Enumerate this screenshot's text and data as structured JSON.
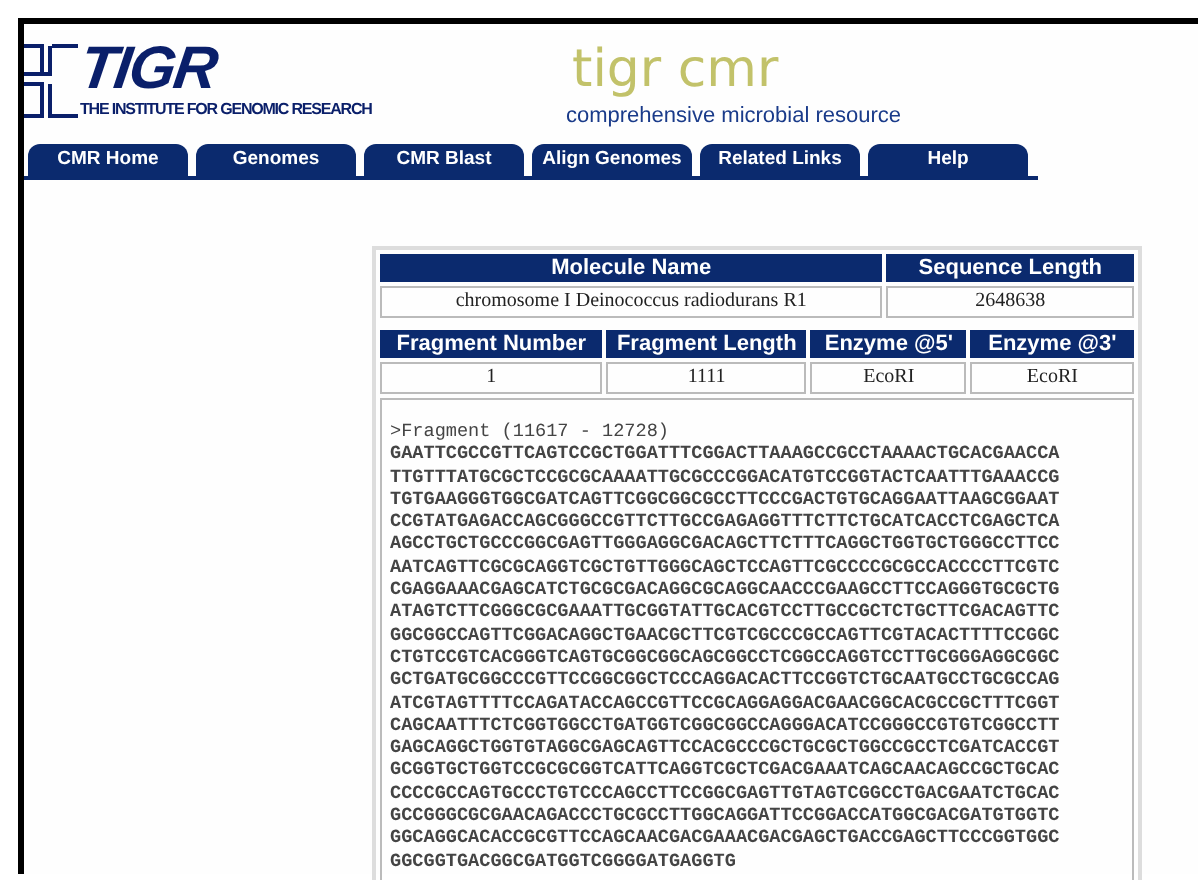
{
  "logo": {
    "name": "TIGR",
    "subtitle": "THE INSTITUTE FOR GENOMIC RESEARCH"
  },
  "site": {
    "title": "tigr cmr",
    "tagline": "comprehensive microbial resource"
  },
  "tabs": [
    "CMR Home",
    "Genomes",
    "CMR Blast",
    "Align Genomes",
    "Related Links",
    "Help"
  ],
  "molecule_table": {
    "columns": [
      "Molecule Name",
      "Sequence Length"
    ],
    "row": [
      "chromosome I Deinococcus radiodurans R1",
      "2648638"
    ]
  },
  "fragment_table": {
    "columns": [
      "Fragment Number",
      "Fragment Length",
      "Enzyme @5'",
      "Enzyme @3'"
    ],
    "row": [
      "1",
      "1111",
      "EcoRI",
      "EcoRI"
    ]
  },
  "sequence": {
    "header": ">Fragment (11617 - 12728)",
    "lines": [
      "GAATTCGCCGTTCAGTCCGCTGGATTTCGGACTTAAAGCCGCCTAAAACTGCACGAACCA",
      "TTGTTTATGCGCTCCGCGCAAAATTGCGCCCGGACATGTCCGGTACTCAATTTGAAACCG",
      "TGTGAAGGGTGGCGATCAGTTCGGCGGCGCCTTCCCGACTGTGCAGGAATTAAGCGGAAT",
      "CCGTATGAGACCAGCGGGCCGTTCTTGCCGAGAGGTTTCTTCTGCATCACCTCGAGCTCA",
      "AGCCTGCTGCCCGGCGAGTTGGGAGGCGACAGCTTCTTTCAGGCTGGTGCTGGGCCTTCC",
      "AATCAGTTCGCGCAGGTCGCTGTTGGGCAGCTCCAGTTCGCCCCGCGCCACCCCTTCGTC",
      "CGAGGAAACGAGCATCTGCGCGACAGGCGCAGGCAACCCGAAGCCTTCCAGGGTGCGCTG",
      "ATAGTCTTCGGGCGCGAAATTGCGGTATTGCACGTCCTTGCCGCTCTGCTTCGACAGTTC",
      "GGCGGCCAGTTCGGACAGGCTGAACGCTTCGTCGCCCGCCAGTTCGTACACTTTTCCGGC",
      "CTGTCCGTCACGGGTCAGTGCGGCGGCAGCGGCCTCGGCCAGGTCCTTGCGGGAGGCGGC",
      "GCTGATGCGGCCCGTTCCGGCGGCTCCCAGGACACTTCCGGTCTGCAATGCCTGCGCCAG",
      "ATCGTAGTTTTCCAGATACCAGCCGTTCCGCAGGAGGACGAACGGCACGCCGCTTTCGGT",
      "CAGCAATTTCTCGGTGGCCTGATGGTCGGCGGCCAGGGACATCCGGGCCGTGTCGGCCTT",
      "GAGCAGGCTGGTGTAGGCGAGCAGTTCCACGCCCGCTGCGCTGGCCGCCTCGATCACCGT",
      "GCGGTGCTGGTCCGCGCGGTCATTCAGGTCGCTCGACGAAATCAGCAACAGCCGCTGCAC",
      "CCCCGCCAGTGCCCTGTCCCAGCCTTCCGGCGAGTTGTAGTCGGCCTGACGAATCTGCAC",
      "GCCGGGCGCGAACAGACCCTGCGCCTTGGCAGGATTCCGGACCATGGCGACGATGTGGTC",
      "GGCAGGCACACCGCGTTCCAGCAACGACGAAACGACGAGCTGACCGAGCTTCCCGGTGGC",
      "GGCGGTGACGGCGATGGTCGGGGATGAGGTG"
    ]
  }
}
